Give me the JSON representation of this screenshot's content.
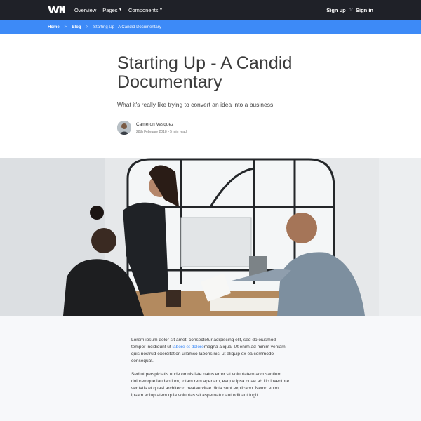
{
  "nav": {
    "logo_icon": "wm-logo-icon",
    "links": [
      {
        "label": "Overview",
        "has_caret": false
      },
      {
        "label": "Pages",
        "has_caret": true
      },
      {
        "label": "Components",
        "has_caret": true
      }
    ],
    "signup": "Sign up",
    "or": "or",
    "signin": "Sign in"
  },
  "breadcrumb": {
    "home": "Home",
    "blog": "Blog",
    "current": "Starting Up - A Candid Documentary",
    "separator": ">"
  },
  "article": {
    "title": "Starting Up - A Candid Documentary",
    "subtitle": "What it's really like trying to convert an idea into a business.",
    "author_name": "Cameron Vasquez",
    "author_meta": "28th February 2018 • 5 min read"
  },
  "body": {
    "p1_before": "Lorem ipsum dolor sit amet, consectetur adipiscing elit, sed do eiusmod tempor incididunt ut ",
    "p1_link": "labore et dolore",
    "p1_after": "magna aliqua. Ut enim ad minim veniam, quis nostrud exercitation ullamco laboris nisi ut aliquip ex ea commodo consequat.",
    "p2": "Sed ut perspiciatis unde omnis iste natus error sit voluptatem accusantium doloremque laudantium, totam rem aperiam, eaque ipsa quae ab illo inventore veritatis et quasi architecto beatae vitae dicta sunt explicabo. Nemo enim ipsam voluptatem quia voluptas sit aspernatur aut odit aut fugit"
  },
  "colors": {
    "navbar": "#1f2128",
    "accent": "#3d8af7",
    "content_bg": "#f7f8fa"
  }
}
